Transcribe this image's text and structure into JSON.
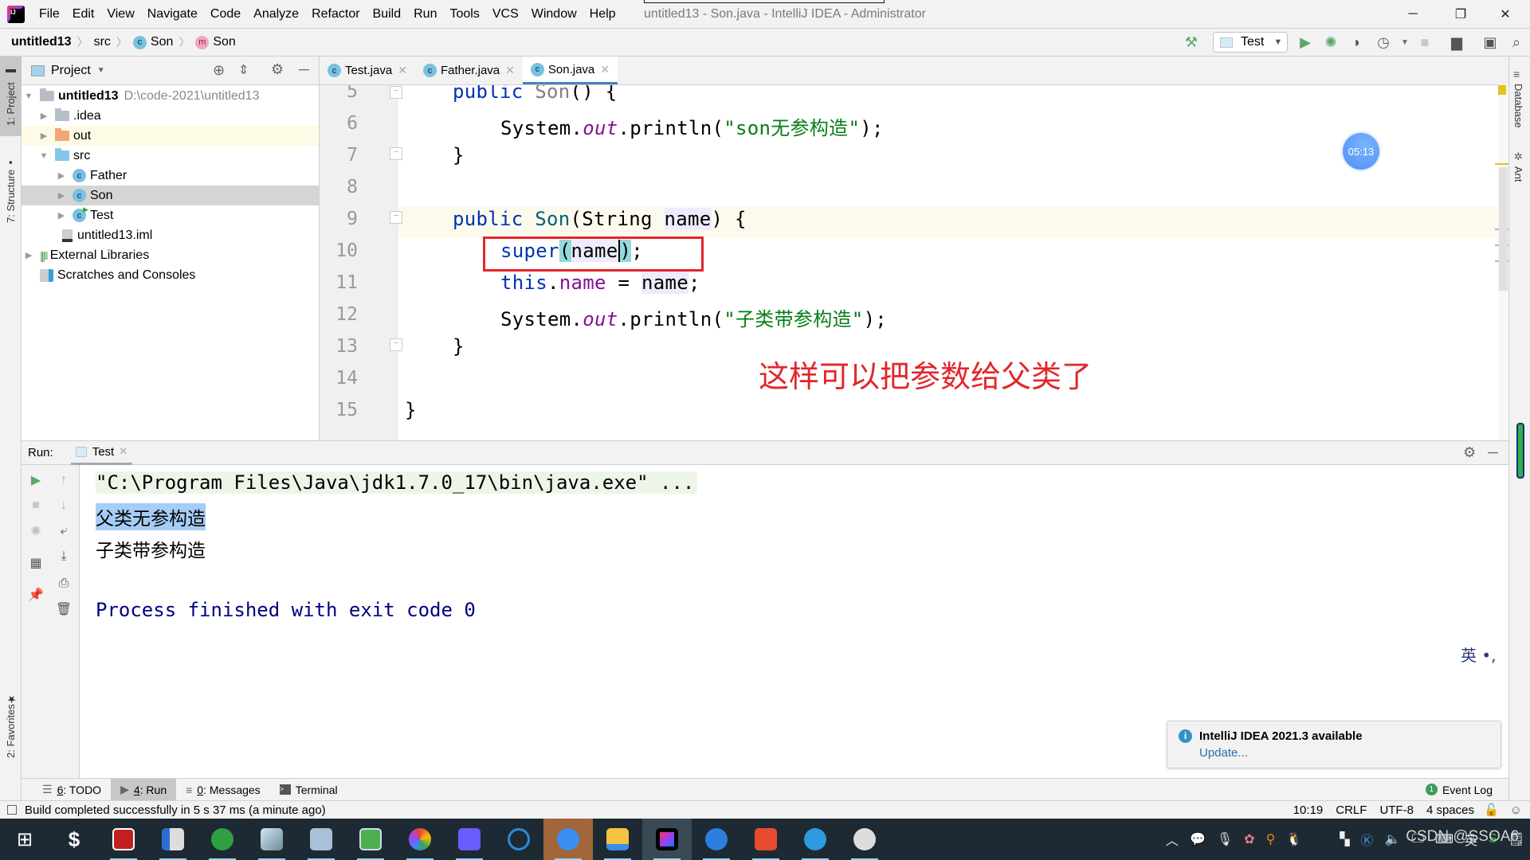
{
  "window": {
    "title": "untitled13 - Son.java - IntelliJ IDEA - Administrator",
    "controls": {
      "minimize": "─",
      "restore": "❐",
      "close": "✕"
    }
  },
  "menu": [
    "File",
    "Edit",
    "View",
    "Navigate",
    "Code",
    "Analyze",
    "Refactor",
    "Build",
    "Run",
    "Tools",
    "VCS",
    "Window",
    "Help"
  ],
  "breadcrumb": {
    "project": "untitled13",
    "folder": "src",
    "class": "Son",
    "method": "Son"
  },
  "toolbar": {
    "run_config": "Test",
    "icons": [
      "build-hammer-icon",
      "run-icon",
      "debug-icon",
      "coverage-icon",
      "profile-icon",
      "stop-icon",
      "project-structure-icon",
      "run-anything-icon",
      "search-icon"
    ]
  },
  "left_stripe": {
    "project_tab": "1: Project",
    "structure_tab": "7: Structure",
    "favorites_tab": "2: Favorites"
  },
  "right_stripe": {
    "database_tab": "Database",
    "ant_tab": "Ant"
  },
  "project_panel": {
    "title": "Project",
    "tree": [
      {
        "label": "untitled13",
        "path": "D:\\code-2021\\untitled13",
        "type": "module",
        "expanded": true
      },
      {
        "label": ".idea",
        "type": "folder-gray"
      },
      {
        "label": "out",
        "type": "folder-orange"
      },
      {
        "label": "src",
        "type": "folder-blue",
        "expanded": true
      },
      {
        "label": "Father",
        "type": "class"
      },
      {
        "label": "Son",
        "type": "class",
        "selected": true
      },
      {
        "label": "Test",
        "type": "class-runnable"
      },
      {
        "label": "untitled13.iml",
        "type": "file"
      },
      {
        "label": "External Libraries",
        "type": "libraries"
      },
      {
        "label": "Scratches and Consoles",
        "type": "scratches"
      }
    ]
  },
  "editor": {
    "tabs": [
      {
        "label": "Test.java",
        "active": false
      },
      {
        "label": "Father.java",
        "active": false
      },
      {
        "label": "Son.java",
        "active": true
      }
    ],
    "lines": [
      {
        "num": "5"
      },
      {
        "num": "6",
        "str": "\"son无参构造\""
      },
      {
        "num": "7"
      },
      {
        "num": "8"
      },
      {
        "num": "9"
      },
      {
        "num": "10"
      },
      {
        "num": "11"
      },
      {
        "num": "12",
        "str": "\"子类带参构造\""
      },
      {
        "num": "13"
      },
      {
        "num": "14"
      },
      {
        "num": "15"
      }
    ],
    "annotation": "这样可以把参数给父类了",
    "timer": "05:13"
  },
  "run_panel": {
    "label": "Run:",
    "tab": "Test",
    "console": [
      "\"C:\\Program Files\\Java\\jdk1.7.0_17\\bin\\java.exe\" ...",
      "父类无参构造",
      "子类带参构造",
      "",
      "Process finished with exit code 0"
    ],
    "ime_indicator": "英 •,"
  },
  "notification": {
    "title": "IntelliJ IDEA 2021.3 available",
    "link": "Update..."
  },
  "bottom_tabs": [
    {
      "key": "6",
      "label": ": TODO"
    },
    {
      "key": "4",
      "label": ": Run",
      "active": true
    },
    {
      "key": "0",
      "label": ": Messages"
    },
    {
      "key": "",
      "label": "Terminal"
    }
  ],
  "event_log": {
    "count": "1",
    "label": "Event Log"
  },
  "status": {
    "message": "Build completed successfully in 5 s 37 ms (a minute ago)",
    "position": "10:19",
    "line_ending": "CRLF",
    "encoding": "UTF-8",
    "indent": "4 spaces"
  },
  "taskbar": {
    "apps": [
      "start",
      "app-s",
      "app-pdf",
      "app-notes",
      "app-browser-e",
      "app-notepad",
      "app-reader",
      "app-green",
      "app-chrome-like",
      "app-circle",
      "app-search",
      "app-feishu",
      "app-explorer",
      "app-intellij",
      "app-k",
      "app-xmind",
      "app-cloud",
      "app-graduation"
    ],
    "watermark": "CSDN @SSOA6"
  },
  "colors": {
    "accent": "#4083c9",
    "annotation_red": "#e2262c",
    "keyword": "#0033b3",
    "string": "#067d17",
    "field": "#871094"
  }
}
